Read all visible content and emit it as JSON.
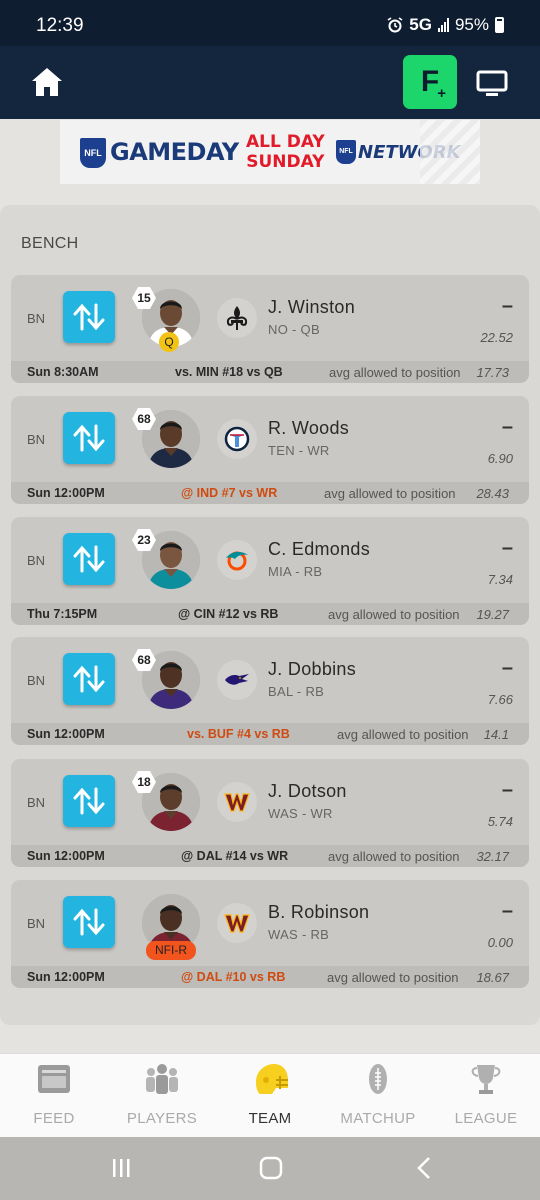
{
  "status": {
    "time": "12:39",
    "network": "5G",
    "battery": "95%"
  },
  "appbar": {
    "fplus_label": "F",
    "fplus_plus": "+"
  },
  "banner": {
    "nfl_mark": "NFL",
    "brand": "GAMEDAY",
    "allday_line1": "ALL DAY",
    "allday_line2": "SUNDAY",
    "network": "NETWORK"
  },
  "bench": {
    "title": "BENCH",
    "players": [
      {
        "slot": "BN",
        "rank": "15",
        "badge": "Q",
        "name": "J. Winston",
        "team_pos": "NO - QB",
        "score": "–",
        "projection": "22.52",
        "game_time": "Sun 8:30AM",
        "matchup": "vs. MIN #18 vs QB",
        "matchup_hot": false,
        "avg_label": "avg allowed to position",
        "avg_value": "17.73",
        "team_icon": "saints-fleur-de-lis-icon"
      },
      {
        "slot": "BN",
        "rank": "68",
        "badge": "",
        "name": "R. Woods",
        "team_pos": "TEN - WR",
        "score": "–",
        "projection": "6.90",
        "game_time": "Sun 12:00PM",
        "matchup": "@ IND #7 vs WR",
        "matchup_hot": true,
        "avg_label": "avg allowed to position",
        "avg_value": "28.43",
        "team_icon": "titans-logo-icon"
      },
      {
        "slot": "BN",
        "rank": "23",
        "badge": "",
        "name": "C. Edmonds",
        "team_pos": "MIA - RB",
        "score": "–",
        "projection": "7.34",
        "game_time": "Thu 7:15PM",
        "matchup": "@ CIN #12 vs RB",
        "matchup_hot": false,
        "avg_label": "avg allowed to position",
        "avg_value": "19.27",
        "team_icon": "dolphins-logo-icon"
      },
      {
        "slot": "BN",
        "rank": "68",
        "badge": "",
        "name": "J. Dobbins",
        "team_pos": "BAL - RB",
        "score": "–",
        "projection": "7.66",
        "game_time": "Sun 12:00PM",
        "matchup": "vs. BUF #4 vs RB",
        "matchup_hot": true,
        "avg_label": "avg allowed to position",
        "avg_value": "14.1",
        "team_icon": "ravens-logo-icon"
      },
      {
        "slot": "BN",
        "rank": "18",
        "badge": "",
        "name": "J. Dotson",
        "team_pos": "WAS - WR",
        "score": "–",
        "projection": "5.74",
        "game_time": "Sun 12:00PM",
        "matchup": "@ DAL #14 vs WR",
        "matchup_hot": false,
        "avg_label": "avg allowed to position",
        "avg_value": "32.17",
        "team_icon": "commanders-w-icon"
      },
      {
        "slot": "BN",
        "rank": "",
        "badge": "NFI-R",
        "name": "B. Robinson",
        "team_pos": "WAS - RB",
        "score": "–",
        "projection": "0.00",
        "game_time": "Sun 12:00PM",
        "matchup": "@ DAL #10 vs RB",
        "matchup_hot": true,
        "avg_label": "avg allowed to position",
        "avg_value": "18.67",
        "team_icon": "commanders-w-icon"
      }
    ]
  },
  "tabs": [
    {
      "label": "FEED",
      "icon": "feed-icon",
      "active": false
    },
    {
      "label": "PLAYERS",
      "icon": "players-icon",
      "active": false
    },
    {
      "label": "TEAM",
      "icon": "helmet-icon",
      "active": true
    },
    {
      "label": "MATCHUP",
      "icon": "football-icon",
      "active": false
    },
    {
      "label": "LEAGUE",
      "icon": "trophy-icon",
      "active": false
    }
  ],
  "colors": {
    "accent_green": "#1dd66b",
    "swap_blue": "#23b5e0",
    "hot_orange": "#cf4b12",
    "team_yellow": "#f2c314"
  }
}
